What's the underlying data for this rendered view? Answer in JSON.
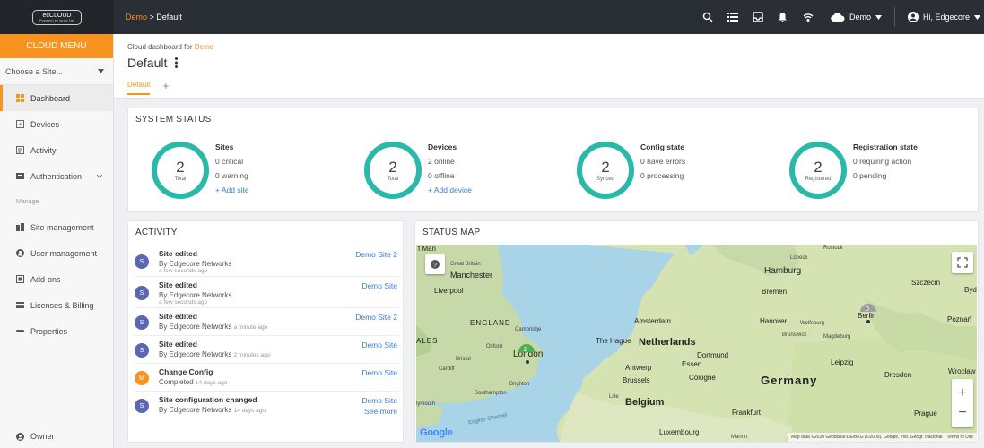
{
  "brand": {
    "logo_text": "ecCLOUD",
    "logo_sub": "Powered by Ignite Net"
  },
  "breadcrumb": {
    "org": "Demo",
    "separator": " > ",
    "page": "Default"
  },
  "topbar": {
    "org_label": "Demo",
    "user_greeting": "Hi, Edgecore"
  },
  "sidebar": {
    "menu_title": "CLOUD MENU",
    "site_select": "Choose a Site...",
    "items": [
      {
        "label": "Dashboard",
        "icon": "dashboard-icon"
      },
      {
        "label": "Devices",
        "icon": "devices-icon"
      },
      {
        "label": "Activity",
        "icon": "activity-icon"
      },
      {
        "label": "Authentication",
        "icon": "authentication-icon"
      }
    ],
    "manage_heading": "Manage",
    "manage_items": [
      {
        "label": "Site management",
        "icon": "site-management-icon"
      },
      {
        "label": "User management",
        "icon": "user-management-icon"
      },
      {
        "label": "Add-ons",
        "icon": "addons-icon"
      },
      {
        "label": "Licenses & Billing",
        "icon": "licenses-icon"
      },
      {
        "label": "Properties",
        "icon": "properties-icon"
      }
    ],
    "owner": "Owner"
  },
  "header": {
    "subtitle_prefix": "Cloud dashboard for ",
    "subtitle_org": "Demo",
    "title": "Default",
    "tab": "Default",
    "add_tab": "+"
  },
  "system_status": {
    "title": "SYSTEM STATUS",
    "groups": [
      {
        "value": "2",
        "ring_label": "Total",
        "title": "Sites",
        "lines": [
          "0 critical",
          "0 warning"
        ],
        "action": "+ Add site"
      },
      {
        "value": "2",
        "ring_label": "Total",
        "title": "Devices",
        "lines": [
          "2 online",
          "0 offline"
        ],
        "action": "+ Add device"
      },
      {
        "value": "2",
        "ring_label": "Synced",
        "title": "Config state",
        "lines": [
          "0 have errors",
          "0 processing"
        ],
        "action": ""
      },
      {
        "value": "2",
        "ring_label": "Registered",
        "title": "Registration state",
        "lines": [
          "0 requiring action",
          "0 pending"
        ],
        "action": ""
      }
    ]
  },
  "activity": {
    "title": "ACTIVITY",
    "items": [
      {
        "avatar": "S",
        "title": "Site edited",
        "by": "By Edgecore Networks",
        "time": "a few seconds ago",
        "link": "Demo Site 2"
      },
      {
        "avatar": "S",
        "title": "Site edited",
        "by": "By Edgecore Networks",
        "time": "a few seconds ago",
        "link": "Demo Site"
      },
      {
        "avatar": "S",
        "title": "Site edited",
        "by": "By Edgecore Networks",
        "time": "a minute ago",
        "link": "Demo Site 2"
      },
      {
        "avatar": "S",
        "title": "Site edited",
        "by": "By Edgecore Networks",
        "time": "2 minutes ago",
        "link": "Demo Site"
      },
      {
        "avatar": "M",
        "title": "Change Config",
        "by": "Completed",
        "time": "14 days ago",
        "link": "Demo Site"
      },
      {
        "avatar": "S",
        "title": "Site configuration changed",
        "by": "By Edgecore Networks",
        "time": "14 days ago",
        "link": "Demo Site"
      }
    ],
    "see_more": "See more"
  },
  "status_map": {
    "title": "STATUS MAP",
    "places": {
      "isle_of_man": "f Man",
      "great_britain": "Great Britain",
      "manchester": "Manchester",
      "liverpool": "Liverpool",
      "england": "ENGLAND",
      "cambridge": "Cambridge",
      "wales": "ALES",
      "oxford": "Oxford",
      "london": "London",
      "bristol": "Bristol",
      "cardiff": "Cardiff",
      "brighton": "Brighton",
      "southampton": "Southampton",
      "plymouth": "lymouth",
      "english_channel": "English Channel",
      "lille": "Lille",
      "rostock": "Rostock",
      "lubeck": "Lübeck",
      "hamburg": "Hamburg",
      "szczecin": "Szczecin",
      "bydgoszcz": "Byd",
      "bremen": "Bremen",
      "amsterdam": "Amsterdam",
      "hanover": "Hanover",
      "wolfsburg": "Wolfsburg",
      "berlin": "Berlin",
      "poznan": "Poznań",
      "brunswick": "Brunswick",
      "magdeburg": "Magdeburg",
      "the_hague": "The Hague",
      "netherlands": "Netherlands",
      "dortmund": "Dortmund",
      "essen": "Essen",
      "antwerp": "Antwerp",
      "leipzig": "Leipzig",
      "dresden": "Dresden",
      "wroclaw": "Wrocław",
      "brussels": "Brussels",
      "cologne": "Cologne",
      "germany": "Germany",
      "belgium": "Belgium",
      "frankfurt": "Frankfurt",
      "prague": "Prague",
      "luxembourg": "Luxembourg",
      "mannheim": "Mannh"
    },
    "markers": [
      {
        "id": "london-marker",
        "value": "2",
        "color": "#4caf50"
      },
      {
        "id": "berlin-marker",
        "value": "0",
        "color": "#9e9e9e"
      }
    ],
    "attribution": "Map data ©2020 GeoBasis-DE/BKG (©2009), Google, Inst. Geogr. Nacional",
    "terms": "Terms of Use",
    "google": "Google",
    "zoom_in": "+",
    "zoom_out": "−",
    "help": "?"
  }
}
